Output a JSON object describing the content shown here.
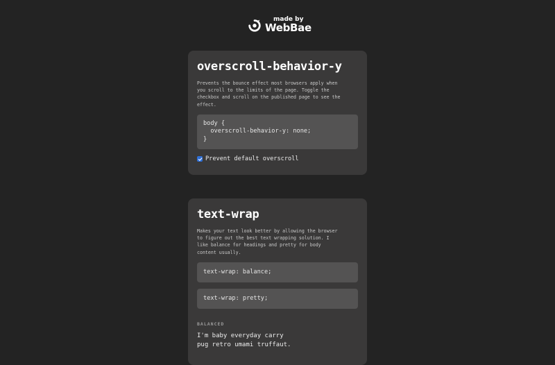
{
  "brand": {
    "small_text": "made by",
    "name": "WebBae"
  },
  "card1": {
    "title": "overscroll-behavior-y",
    "description": "Prevents the bounce effect most browsers apply when you scroll to the limits of the page. Toggle the checkbox and scroll on the published page to see the effect.",
    "code": "body {\n  overscroll-behavior-y: none;\n}",
    "checkbox_label": "Prevent default overscroll",
    "checkbox_checked": true
  },
  "card2": {
    "title": "text-wrap",
    "description": "Makes your text look better by allowing the browser to figure out the best text wrapping solution. I like balance for headings and pretty for body content usually.",
    "code_balance": "text-wrap: balance;",
    "code_pretty": "text-wrap: pretty;",
    "section_label": "BALANCED",
    "sample_line1": "I'm baby everyday carry",
    "sample_line2": "pug retro umami truffaut."
  },
  "colors": {
    "background": "#232323",
    "card": "#3a3939",
    "code_block": "#545353",
    "checkbox_accent": "#2f6fd6"
  }
}
